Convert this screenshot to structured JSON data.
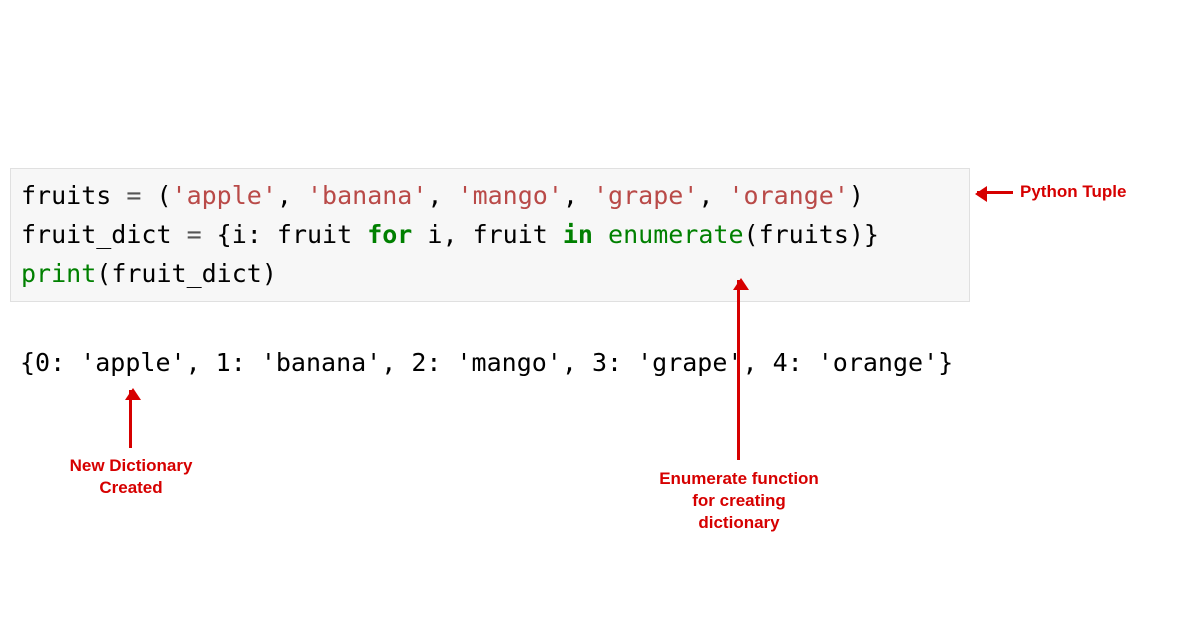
{
  "code": {
    "line1": {
      "var": "fruits",
      "eq": " = ",
      "lp": "(",
      "s1": "'apple'",
      "c1": ", ",
      "s2": "'banana'",
      "c2": ", ",
      "s3": "'mango'",
      "c3": ", ",
      "s4": "'grape'",
      "c4": ", ",
      "s5": "'orange'",
      "rp": ")"
    },
    "blank": "",
    "line3": {
      "var": "fruit_dict",
      "eq": " = ",
      "lb": "{",
      "expr1": "i: fruit ",
      "kw_for": "for",
      "expr2": " i, fruit ",
      "kw_in": "in",
      "sp": " ",
      "fn": "enumerate",
      "call": "(fruits)}"
    },
    "line4": {
      "fn": "print",
      "call": "(fruit_dict)"
    }
  },
  "output": "{0: 'apple', 1: 'banana', 2: 'mango', 3: 'grape', 4: 'orange'}",
  "annotations": {
    "tuple": "Python Tuple",
    "enumerate": "Enumerate function\nfor creating\ndictionary",
    "dict": "New Dictionary\nCreated"
  }
}
